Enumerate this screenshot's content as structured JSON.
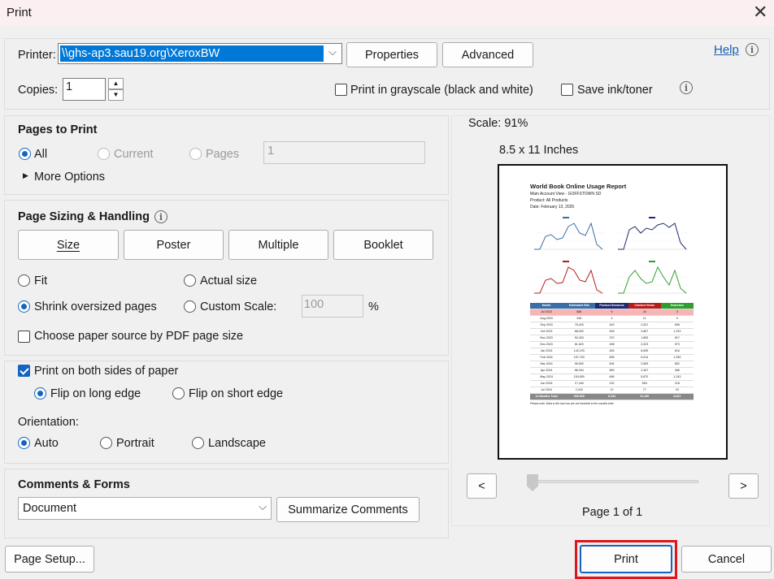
{
  "window": {
    "title": "Print",
    "close": "✕"
  },
  "printer": {
    "label": "Printer:",
    "value": "\\\\ghs-ap3.sau19.org\\XeroxBW",
    "properties": "Properties",
    "advanced": "Advanced",
    "help": "Help"
  },
  "copies": {
    "label": "Copies:",
    "value": "1"
  },
  "options": {
    "grayscale": "Print in grayscale (black and white)",
    "save_ink": "Save ink/toner"
  },
  "pages": {
    "heading": "Pages to Print",
    "all": "All",
    "current": "Current",
    "pages": "Pages",
    "pages_value": "1",
    "more": "More Options"
  },
  "sizing": {
    "heading": "Page Sizing & Handling",
    "tabs": [
      "Size",
      "Poster",
      "Multiple",
      "Booklet"
    ],
    "fit": "Fit",
    "actual": "Actual size",
    "shrink": "Shrink oversized pages",
    "custom": "Custom Scale:",
    "scale_value": "100",
    "percent": "%",
    "paper_source": "Choose paper source by PDF page size"
  },
  "duplex": {
    "both_sides": "Print on both sides of paper",
    "long": "Flip on long edge",
    "short": "Flip on short edge",
    "orientation": "Orientation:",
    "auto": "Auto",
    "portrait": "Portrait",
    "landscape": "Landscape"
  },
  "comments": {
    "heading": "Comments & Forms",
    "value": "Document",
    "summarize": "Summarize Comments"
  },
  "preview": {
    "scale": "Scale:  91%",
    "size": "8.5 x 11 Inches",
    "prev": "<",
    "next": ">",
    "page": "Page 1 of 1",
    "slider_pos": 0
  },
  "doc": {
    "title": "World Book Online Usage Report",
    "line1": "Main Account View - GOFFSTOWN SD",
    "line2": "Product: All Products",
    "line3": "Date: February 13, 2025",
    "headers": [
      "Month",
      "Estimated Hits",
      "Product Sessions",
      "Content Views",
      "Searches"
    ],
    "rows": [
      [
        "Jul 2023",
        "688",
        "5",
        "34",
        "0"
      ],
      [
        "Aug 2023",
        "346",
        "4",
        "11",
        "0"
      ],
      [
        "Sep 2023",
        "75,443",
        "443",
        "2,521",
        "838"
      ],
      [
        "Oct 2023",
        "88,093",
        "528",
        "2,857",
        "1,223"
      ],
      [
        "Nov 2023",
        "52,493",
        "370",
        "1,863",
        "817"
      ],
      [
        "Dec 2023",
        "61,620",
        "498",
        "2,023",
        "573"
      ],
      [
        "Jan 2024",
        "142,193",
        "453",
        "6,695",
        "616"
      ],
      [
        "Feb 2024",
        "157,793",
        "595",
        "5,914",
        "1,399"
      ],
      [
        "Mar 2024",
        "96,590",
        "694",
        "2,659",
        "852"
      ],
      [
        "Apr 2024",
        "86,344",
        "583",
        "2,267",
        "386"
      ],
      [
        "May 2024",
        "154,590",
        "696",
        "5,870",
        "1,243"
      ],
      [
        "Jun 2024",
        "17,440",
        "132",
        "554",
        "218"
      ],
      [
        "Jul 2024",
        "2,243",
        "12",
        "77",
        "23"
      ]
    ],
    "total": [
      "12-Months Total",
      "935,965",
      "5,344",
      "32,456",
      "8,601"
    ],
    "note": "Please note: Data in the last row are not included in the months total"
  },
  "footer": {
    "page_setup": "Page Setup...",
    "print": "Print",
    "cancel": "Cancel"
  },
  "colors": {
    "accent": "#1565c0",
    "highlight": "#e0141b"
  }
}
